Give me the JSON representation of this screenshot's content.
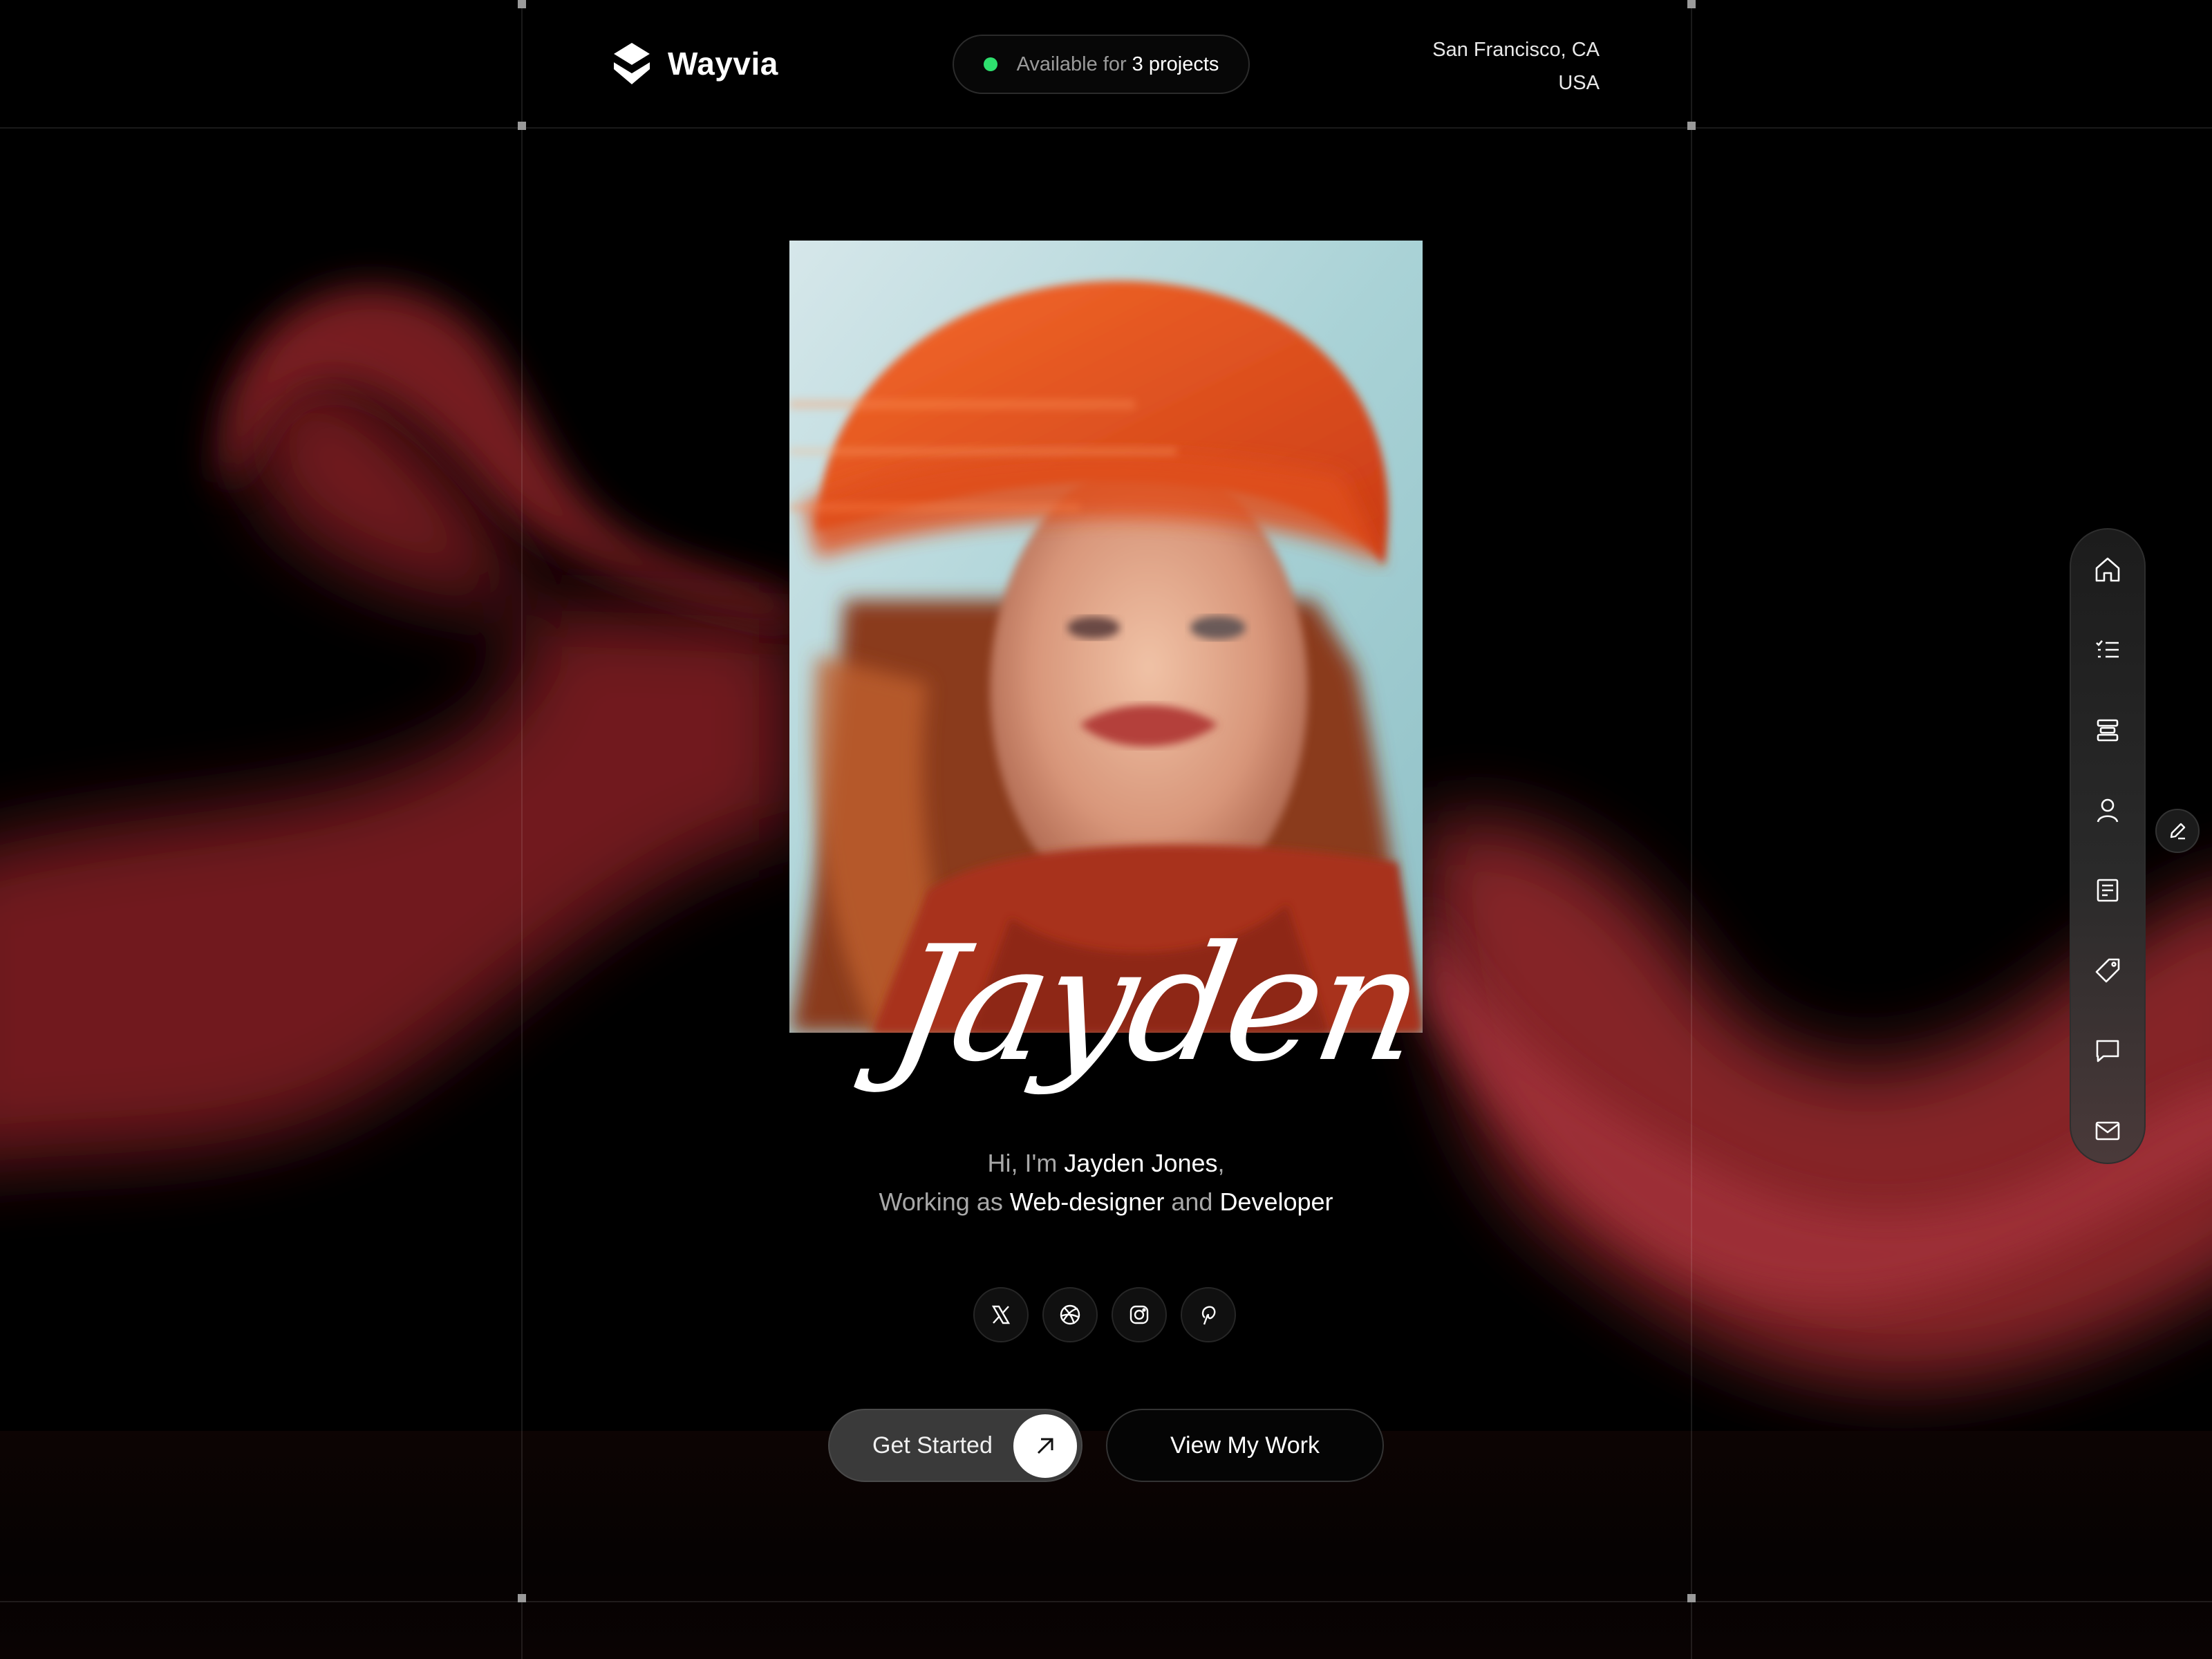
{
  "brand": {
    "name": "Wayvia",
    "icon": "diamond-logo-icon"
  },
  "availability": {
    "prefix": "Available for",
    "count": "3 projects",
    "status_color": "#2ee06e"
  },
  "location": {
    "line1": "San Francisco, CA",
    "line2": "USA"
  },
  "hero": {
    "signature": "Jayden",
    "intro_hi": "Hi, I'm",
    "intro_name": "Jayden Jones",
    "intro_comma": ",",
    "intro_working": "Working as",
    "intro_role1": "Web-designer",
    "intro_and": "and",
    "intro_role2": "Developer"
  },
  "social": [
    {
      "name": "x-icon"
    },
    {
      "name": "dribbble-icon"
    },
    {
      "name": "instagram-icon"
    },
    {
      "name": "pinterest-icon"
    }
  ],
  "cta": {
    "primary": "Get Started",
    "secondary": "View My Work"
  },
  "sidenav": [
    {
      "name": "home-icon"
    },
    {
      "name": "checklist-icon"
    },
    {
      "name": "services-icon"
    },
    {
      "name": "user-icon"
    },
    {
      "name": "document-icon"
    },
    {
      "name": "tag-icon"
    },
    {
      "name": "chat-icon"
    },
    {
      "name": "mail-icon"
    }
  ],
  "colors": {
    "accent": "#a32a30",
    "background": "#000000",
    "text": "#ffffff",
    "muted": "#a8a8a8"
  }
}
